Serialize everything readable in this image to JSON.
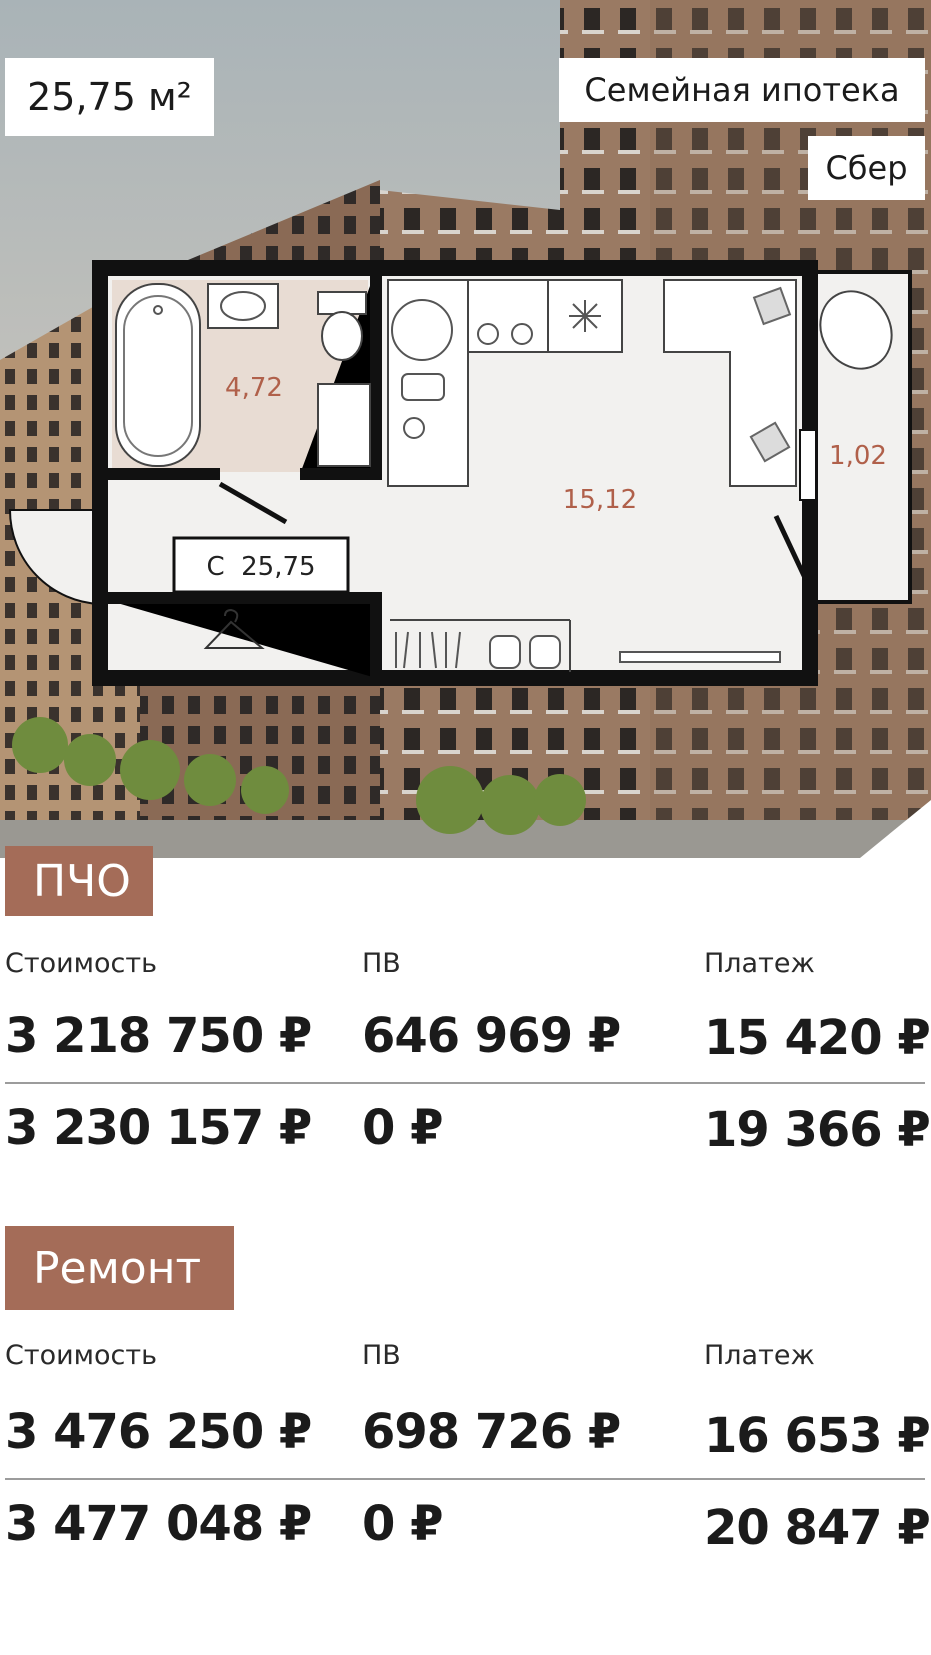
{
  "hero": {
    "area_badge": "25,75 м²",
    "mortgage_badge": "Семейная ипотека",
    "bank_badge": "Сбер"
  },
  "floorplan": {
    "bathroom_area": "4,72",
    "room_area": "15,12",
    "balcony_area": "1,02",
    "total_label": "С  25,75"
  },
  "sections": [
    {
      "title": "ПЧО",
      "labels": {
        "cost": "Стоимость",
        "down_payment": "ПВ",
        "payment": "Платеж"
      },
      "rows": [
        {
          "cost": "3 218 750 ₽",
          "down_payment": "646 969 ₽",
          "payment": "15 420 ₽"
        },
        {
          "cost": "3 230 157 ₽",
          "down_payment": "0 ₽",
          "payment": "19 366 ₽"
        }
      ]
    },
    {
      "title": "Ремонт",
      "labels": {
        "cost": "Стоимость",
        "down_payment": "ПВ",
        "payment": "Платеж"
      },
      "rows": [
        {
          "cost": "3 476 250 ₽",
          "down_payment": "698 726 ₽",
          "payment": "16 653 ₽"
        },
        {
          "cost": "3 477 048 ₽",
          "down_payment": "0 ₽",
          "payment": "20 847 ₽"
        }
      ]
    }
  ],
  "colors": {
    "accent": "#a46c58",
    "room_label": "#b0604a"
  }
}
